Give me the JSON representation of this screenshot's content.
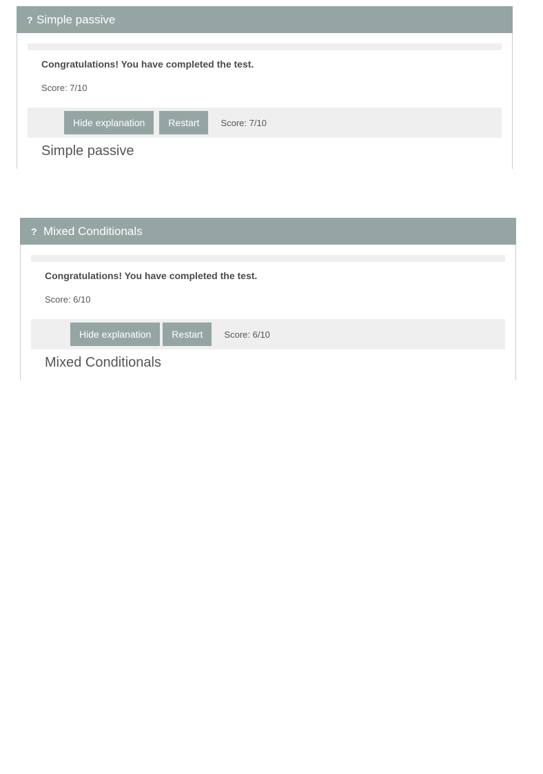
{
  "quizzes": [
    {
      "title": "Simple passive",
      "congrats": "Congratulations! You have completed the test.",
      "score": "Score: 7/10",
      "hide_explanation_label": "Hide explanation",
      "restart_label": "Restart",
      "bar_score": "Score: 7/10",
      "subtitle": "Simple passive"
    },
    {
      "title": "Mixed Conditionals",
      "congrats": "Congratulations! You have completed the test.",
      "score": "Score: 6/10",
      "hide_explanation_label": "Hide explanation",
      "restart_label": "Restart",
      "bar_score": "Score: 6/10",
      "subtitle": "Mixed Conditionals"
    }
  ],
  "icons": {
    "question_glyph": "?"
  },
  "colors": {
    "header_bg": "#95a5a4",
    "button_bg": "#95a5a4",
    "bar_bg": "#efefef"
  }
}
